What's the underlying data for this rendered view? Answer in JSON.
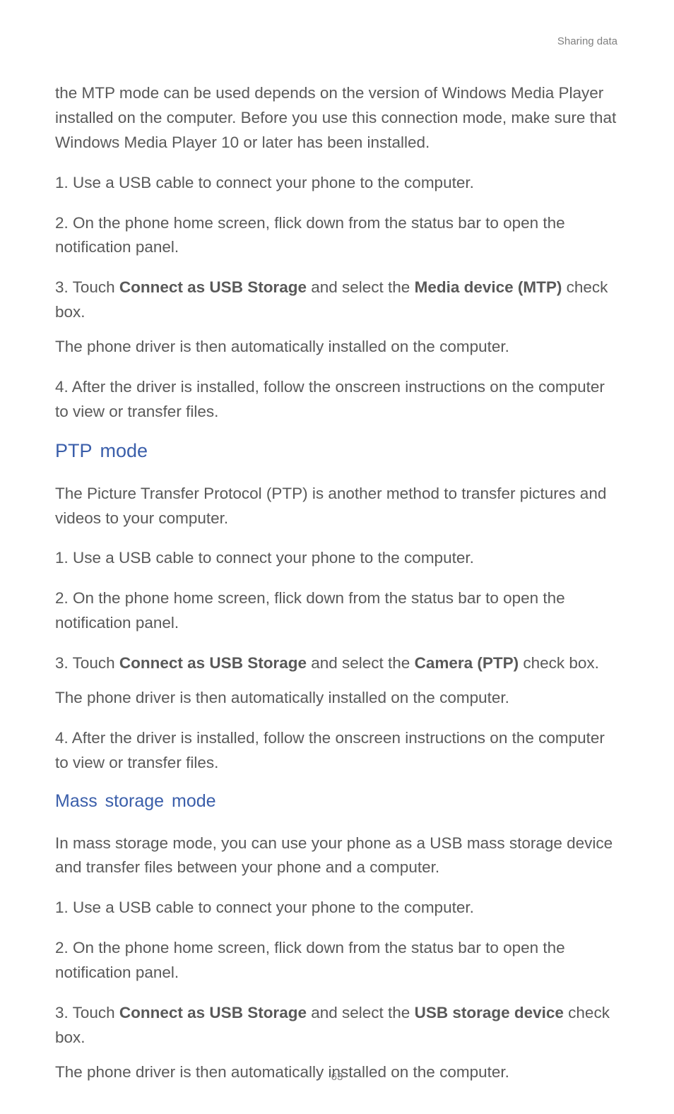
{
  "header": {
    "label": "Sharing data"
  },
  "intro_mtp": "the MTP mode can be used depends on the version of Windows Media Player installed on the computer. Before you use this connection mode, make sure that Windows Media Player 10 or later has been installed.",
  "steps_mtp": {
    "s1": "1. Use a USB cable to connect your phone to the computer.",
    "s2": "2. On the phone home screen, flick down from the status bar to open the notification panel.",
    "s3_num": "3. ",
    "s3_a": "Touch ",
    "s3_bold1": "Connect as USB Storage",
    "s3_b": " and select the ",
    "s3_bold2": "Media device (MTP)",
    "s3_c": " check box.",
    "s3_sub": "The phone driver is then automatically installed on the computer.",
    "s4": "4. After the driver is installed, follow the onscreen instructions on the computer to view or transfer files."
  },
  "section_ptp": {
    "title": "PTP mode"
  },
  "intro_ptp": "The Picture Transfer Protocol (PTP) is another method to transfer pictures and videos to your computer.",
  "steps_ptp": {
    "s1": "1. Use a USB cable to connect your phone to the computer.",
    "s2": "2. On the phone home screen, flick down from the status bar to open the notification panel.",
    "s3_num": "3. ",
    "s3_a": "Touch ",
    "s3_bold1": "Connect as USB Storage",
    "s3_b": " and select the ",
    "s3_bold2": "Camera (PTP)",
    "s3_c": " check box.",
    "s3_sub": "The phone driver is then automatically installed on the computer.",
    "s4": "4. After the driver is installed, follow the onscreen instructions on the computer to view or transfer files."
  },
  "section_mass": {
    "title": "Mass storage mode"
  },
  "intro_mass": "In mass storage mode, you can use your phone as a USB mass storage device and transfer files between your phone and a computer.",
  "steps_mass": {
    "s1": "1. Use a USB cable to connect your phone to the computer.",
    "s2": "2. On the phone home screen, flick down from the status bar to open the notification panel.",
    "s3_num": "3. ",
    "s3_a": "Touch ",
    "s3_bold1": "Connect as USB Storage",
    "s3_b": " and select the ",
    "s3_bold2": "USB storage device",
    "s3_c": " check box.",
    "s3_sub": "The phone driver is then automatically installed on the computer."
  },
  "page_number": "63"
}
